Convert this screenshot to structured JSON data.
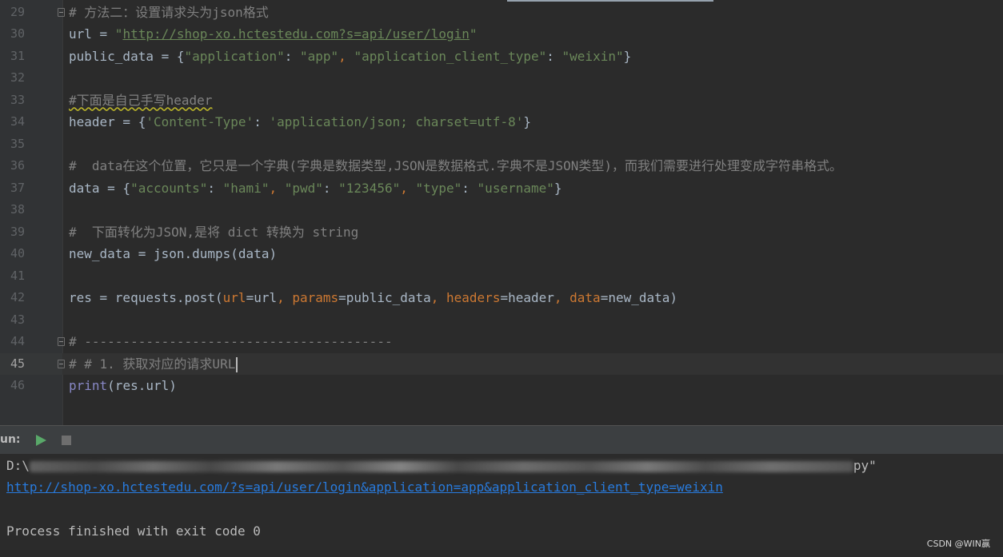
{
  "editor": {
    "lines": [
      {
        "num": "29",
        "tokens": [
          {
            "t": "# 方法二：设置请求头为json格式",
            "c": "cm"
          }
        ]
      },
      {
        "num": "30",
        "tokens": [
          {
            "t": "url = ",
            "c": ""
          },
          {
            "t": "\"",
            "c": "str"
          },
          {
            "t": "http://shop-xo.hctestedu.com?s=api/user/login",
            "c": "url"
          },
          {
            "t": "\"",
            "c": "str"
          }
        ]
      },
      {
        "num": "31",
        "tokens": [
          {
            "t": "public_data = {",
            "c": ""
          },
          {
            "t": "\"application\"",
            "c": "str"
          },
          {
            "t": ": ",
            "c": ""
          },
          {
            "t": "\"app\"",
            "c": "str"
          },
          {
            "t": ", ",
            "c": "punc"
          },
          {
            "t": "\"application_client_type\"",
            "c": "str"
          },
          {
            "t": ": ",
            "c": ""
          },
          {
            "t": "\"weixin\"",
            "c": "str"
          },
          {
            "t": "}",
            "c": ""
          }
        ]
      },
      {
        "num": "32",
        "tokens": []
      },
      {
        "num": "33",
        "tokens": [
          {
            "t": "#下面是自己手写header",
            "c": "cm warnul"
          }
        ]
      },
      {
        "num": "34",
        "tokens": [
          {
            "t": "header = {",
            "c": ""
          },
          {
            "t": "'Content-Type'",
            "c": "str"
          },
          {
            "t": ": ",
            "c": ""
          },
          {
            "t": "'application/json; charset=utf-8'",
            "c": "str"
          },
          {
            "t": "}",
            "c": ""
          }
        ]
      },
      {
        "num": "35",
        "tokens": []
      },
      {
        "num": "36",
        "tokens": [
          {
            "t": "#  data在这个位置，它只是一个字典(字典是数据类型,JSON是数据格式.字典不是JSON类型)，而我们需要进行处理变成字符串格式。",
            "c": "cm"
          }
        ]
      },
      {
        "num": "37",
        "tokens": [
          {
            "t": "data = {",
            "c": ""
          },
          {
            "t": "\"accounts\"",
            "c": "str"
          },
          {
            "t": ": ",
            "c": ""
          },
          {
            "t": "\"hami\"",
            "c": "str"
          },
          {
            "t": ", ",
            "c": "punc"
          },
          {
            "t": "\"pwd\"",
            "c": "str"
          },
          {
            "t": ": ",
            "c": ""
          },
          {
            "t": "\"123456\"",
            "c": "str"
          },
          {
            "t": ", ",
            "c": "punc"
          },
          {
            "t": "\"type\"",
            "c": "str"
          },
          {
            "t": ": ",
            "c": ""
          },
          {
            "t": "\"username\"",
            "c": "str"
          },
          {
            "t": "}",
            "c": ""
          }
        ]
      },
      {
        "num": "38",
        "tokens": []
      },
      {
        "num": "39",
        "tokens": [
          {
            "t": "#  下面转化为JSON,是将 dict 转换为 string",
            "c": "cm"
          }
        ]
      },
      {
        "num": "40",
        "tokens": [
          {
            "t": "new_data = json.dumps(data)",
            "c": ""
          }
        ]
      },
      {
        "num": "41",
        "tokens": []
      },
      {
        "num": "42",
        "tokens": [
          {
            "t": "res = requests.post(",
            "c": ""
          },
          {
            "t": "url",
            "c": "kw"
          },
          {
            "t": "=url",
            "c": ""
          },
          {
            "t": ", ",
            "c": "punc"
          },
          {
            "t": "params",
            "c": "kw"
          },
          {
            "t": "=public_data",
            "c": ""
          },
          {
            "t": ", ",
            "c": "punc"
          },
          {
            "t": "headers",
            "c": "kw"
          },
          {
            "t": "=header",
            "c": ""
          },
          {
            "t": ", ",
            "c": "punc"
          },
          {
            "t": "data",
            "c": "kw"
          },
          {
            "t": "=new_data)",
            "c": ""
          }
        ]
      },
      {
        "num": "43",
        "tokens": []
      },
      {
        "num": "44",
        "tokens": [
          {
            "t": "# ----------------------------------------",
            "c": "cm"
          }
        ]
      },
      {
        "num": "45",
        "tokens": [
          {
            "t": "# # 1. 获取对应的请求URL",
            "c": "cm"
          }
        ]
      },
      {
        "num": "46",
        "tokens": [
          {
            "t": "print",
            "c": "builtin"
          },
          {
            "t": "(res.url)",
            "c": ""
          }
        ]
      }
    ],
    "current_line": "45",
    "fold_markers": [
      "29",
      "44",
      "45"
    ]
  },
  "run_panel": {
    "label": "un:",
    "run_icon": "play-icon",
    "stop_icon": "stop-icon"
  },
  "console": {
    "path_prefix": "D:\\",
    "path_suffix": "py\"",
    "output_url": "http://shop-xo.hctestedu.com/?s=api/user/login&application=app&application_client_type=weixin",
    "exit_message": "Process finished with exit code 0"
  },
  "watermark": "CSDN @WIN赢",
  "colors": {
    "background": "#2b2b2b",
    "comment": "#808080",
    "string": "#6a8759",
    "keyword": "#cc7832",
    "builtin": "#8888c6",
    "link": "#287bde",
    "run_green": "#59a869"
  }
}
